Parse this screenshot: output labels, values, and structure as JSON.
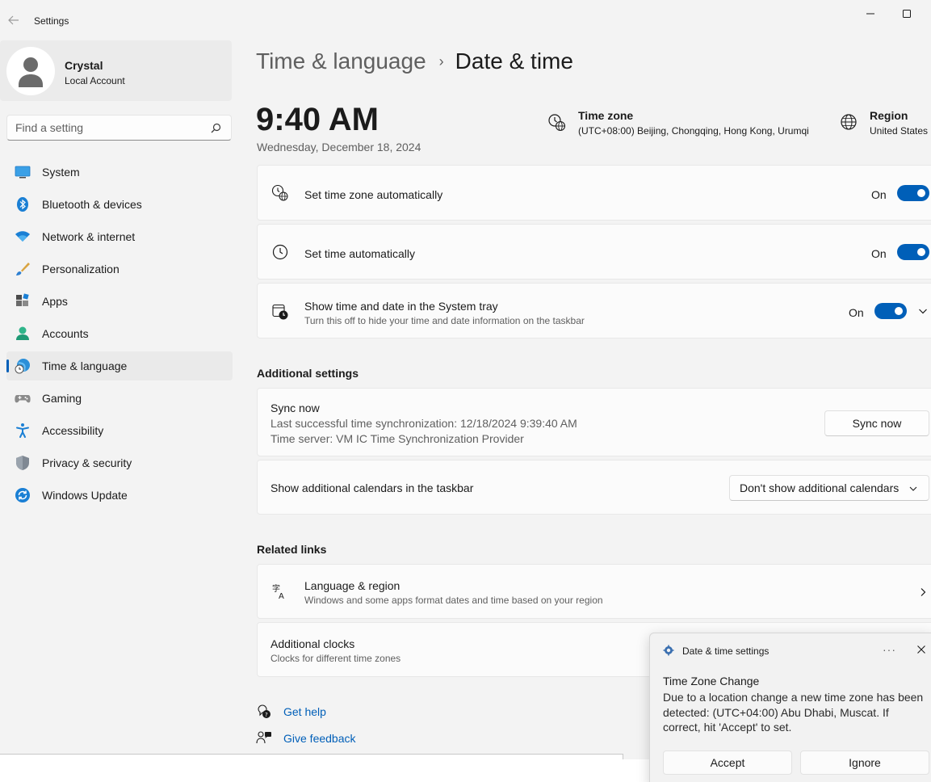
{
  "window": {
    "title": "Settings"
  },
  "user": {
    "name": "Crystal",
    "account_type": "Local Account"
  },
  "search": {
    "placeholder": "Find a setting"
  },
  "sidebar": {
    "items": [
      {
        "label": "System",
        "icon": "system-icon"
      },
      {
        "label": "Bluetooth & devices",
        "icon": "bluetooth-icon"
      },
      {
        "label": "Network & internet",
        "icon": "wifi-icon"
      },
      {
        "label": "Personalization",
        "icon": "brush-icon"
      },
      {
        "label": "Apps",
        "icon": "apps-icon"
      },
      {
        "label": "Accounts",
        "icon": "accounts-icon"
      },
      {
        "label": "Time & language",
        "icon": "time-language-icon",
        "active": true
      },
      {
        "label": "Gaming",
        "icon": "gamepad-icon"
      },
      {
        "label": "Accessibility",
        "icon": "accessibility-icon"
      },
      {
        "label": "Privacy & security",
        "icon": "shield-icon"
      },
      {
        "label": "Windows Update",
        "icon": "update-icon"
      }
    ]
  },
  "breadcrumb": {
    "parent": "Time & language",
    "separator": "›",
    "current": "Date & time"
  },
  "clock": {
    "time": "9:40 AM",
    "date": "Wednesday, December 18, 2024"
  },
  "timezone": {
    "label": "Time zone",
    "value": "(UTC+08:00) Beijing, Chongqing, Hong Kong, Urumqi"
  },
  "region": {
    "label": "Region",
    "value": "United States"
  },
  "settings": {
    "tz_auto": {
      "title": "Set time zone automatically",
      "state": "On"
    },
    "time_auto": {
      "title": "Set time automatically",
      "state": "On"
    },
    "tray": {
      "title": "Show time and date in the System tray",
      "subtitle": "Turn this off to hide your time and date information on the taskbar",
      "state": "On"
    }
  },
  "additional": {
    "heading": "Additional settings",
    "sync": {
      "title": "Sync now",
      "last_sync": "Last successful time synchronization: 12/18/2024 9:39:40 AM",
      "server": "Time server: VM IC Time Synchronization Provider",
      "button": "Sync now"
    },
    "calendars": {
      "title": "Show additional calendars in the taskbar",
      "selected": "Don't show additional calendars"
    }
  },
  "related": {
    "heading": "Related links",
    "lang_region": {
      "title": "Language & region",
      "subtitle": "Windows and some apps format dates and time based on your region"
    },
    "clocks": {
      "title": "Additional clocks",
      "subtitle": "Clocks for different time zones"
    }
  },
  "help": {
    "get_help": "Get help",
    "feedback": "Give feedback"
  },
  "toast": {
    "app": "Date & time settings",
    "more": "···",
    "title": "Time Zone Change",
    "body": "Due to a location change a new time zone has been detected: (UTC+04:00) Abu Dhabi, Muscat. If correct, hit 'Accept' to set.",
    "accept": "Accept",
    "ignore": "Ignore"
  },
  "colors": {
    "accent": "#005fb8",
    "background": "#f3f3f3",
    "card": "#fbfbfb"
  }
}
